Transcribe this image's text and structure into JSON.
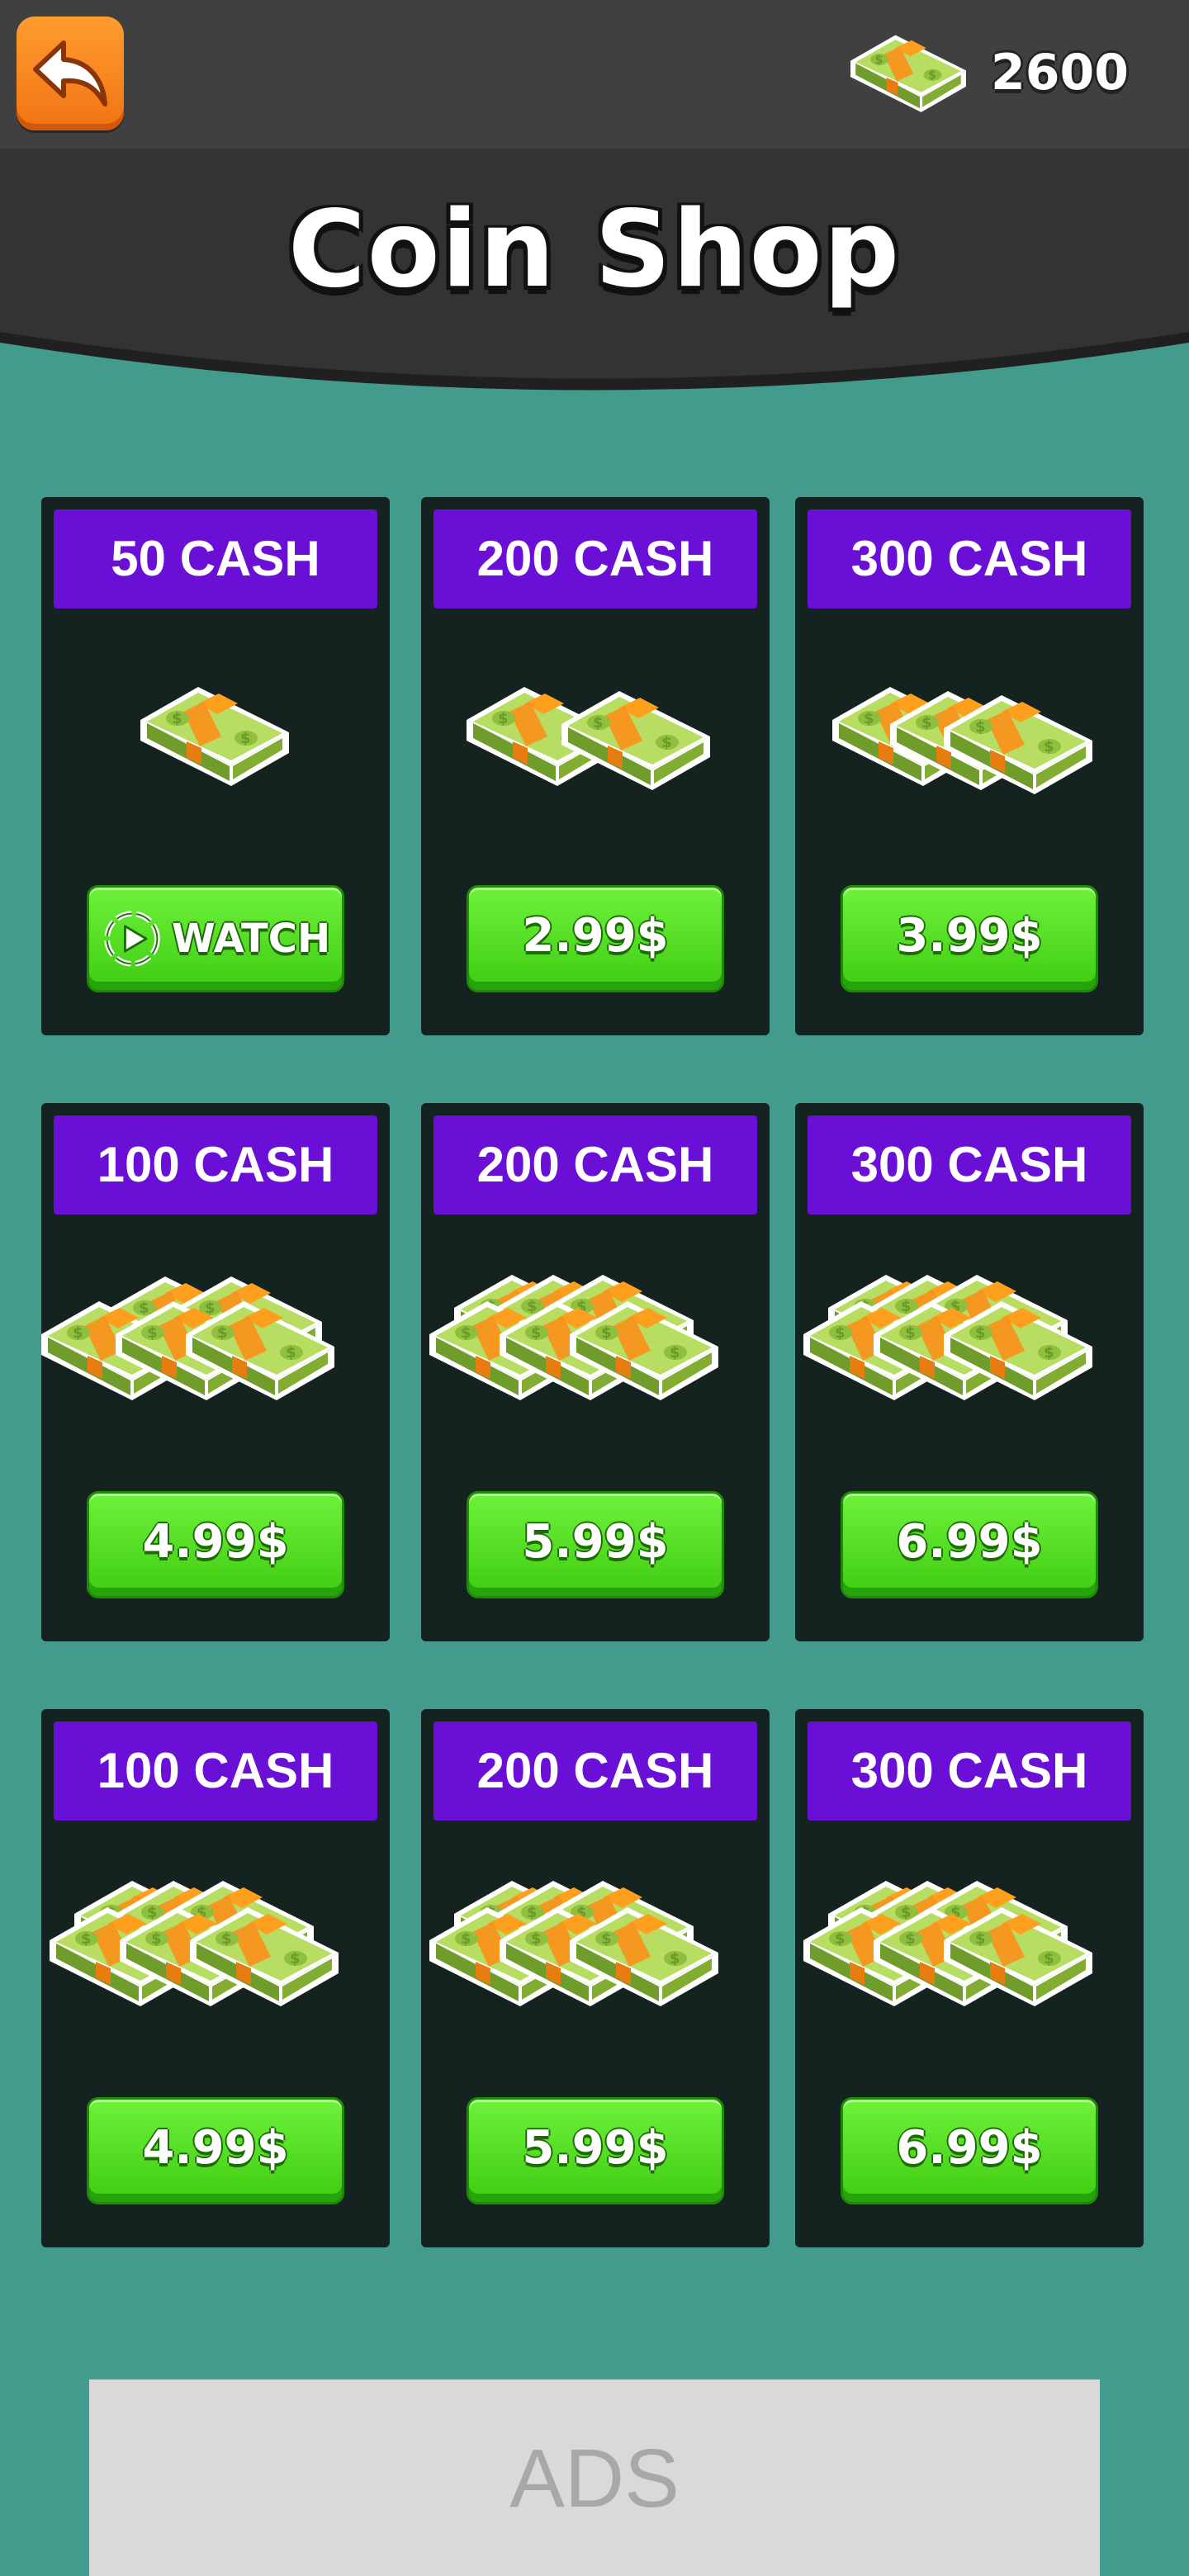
{
  "header": {
    "balance": "2600",
    "balance_icon": "cash-stack-icon",
    "back_icon": "back-arrow-icon",
    "title": "Coin Shop"
  },
  "colors": {
    "background": "#439b8d",
    "topbar": "#404040",
    "banner": "#333333",
    "card": "#142220",
    "label": "#6a10d6",
    "button_green": "#4fdc20",
    "back_button": "#f7841f"
  },
  "packs": [
    {
      "label": "50 CASH",
      "price": "WATCH",
      "stacks": 1,
      "type": "watch"
    },
    {
      "label": "200 CASH",
      "price": "2.99$",
      "stacks": 2,
      "type": "buy"
    },
    {
      "label": "300 CASH",
      "price": "3.99$",
      "stacks": 3,
      "type": "buy"
    },
    {
      "label": "100 CASH",
      "price": "4.99$",
      "stacks": 5,
      "type": "buy"
    },
    {
      "label": "200 CASH",
      "price": "5.99$",
      "stacks": 6,
      "type": "buy"
    },
    {
      "label": "300 CASH",
      "price": "6.99$",
      "stacks": 6,
      "type": "buy"
    },
    {
      "label": "100 CASH",
      "price": "4.99$",
      "stacks": 6,
      "type": "buy"
    },
    {
      "label": "200 CASH",
      "price": "5.99$",
      "stacks": 6,
      "type": "buy"
    },
    {
      "label": "300 CASH",
      "price": "6.99$",
      "stacks": 6,
      "type": "buy"
    }
  ],
  "ads": {
    "label": "ADS"
  }
}
